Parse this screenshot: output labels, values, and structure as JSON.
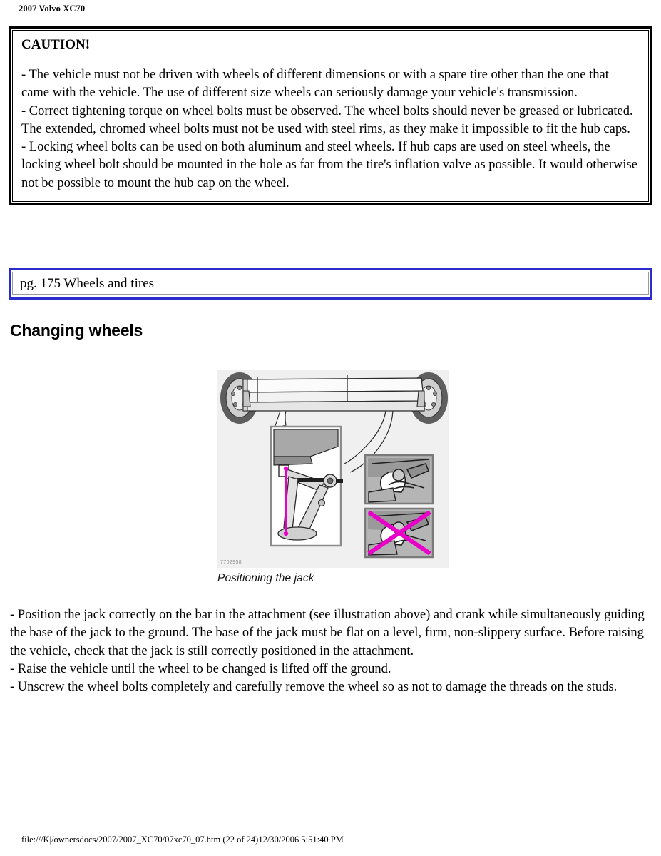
{
  "header": {
    "title": "2007 Volvo XC70"
  },
  "caution": {
    "title": "CAUTION!",
    "paragraphs": [
      "- The vehicle must not be driven with wheels of different dimensions or with a spare tire other than the one that came with the vehicle. The use of different size wheels can seriously damage your vehicle's transmission.",
      "- Correct tightening torque on wheel bolts must be observed. The wheel bolts should never be greased or lubricated. The extended, chromed wheel bolts must not be used with steel rims, as they make it impossible to fit the hub caps.",
      "- Locking wheel bolts can be used on both aluminum and steel wheels. If hub caps are used on steel wheels, the locking wheel bolt should be mounted in the hole as far from the tire's inflation valve as possible. It would otherwise not be possible to mount the hub cap on the wheel."
    ],
    "border_color": "#000000"
  },
  "reference_box": {
    "text": "pg. 175 Wheels and tires",
    "border_color": "#2c2ccc",
    "inner_border_color": "#9a9a9a"
  },
  "section": {
    "heading": "Changing wheels"
  },
  "figure": {
    "caption": "Positioning the jack",
    "image_id": "7702958",
    "background_color": "#f0f0f0",
    "highlight_color": "#e800c8",
    "alt": "Illustration of a vehicle side sill with jack attachment points, a detail view of the jack positioned on the bar in the attachment, a correct-placement inset and an incorrect-placement inset marked with a cross"
  },
  "body": {
    "paragraphs": [
      "- Position the jack correctly on the bar in the attachment (see illustration above) and crank while simultaneously guiding the base of the jack to the ground. The base of the jack must be flat on a level, firm, non-slippery surface. Before raising the vehicle, check that the jack is still correctly positioned in the attachment.",
      "- Raise the vehicle until the wheel to be changed is lifted off the ground.",
      "- Unscrew the wheel bolts completely and carefully remove the wheel so as not to damage the threads on the studs."
    ]
  },
  "footer": {
    "path": "file:///K|/ownersdocs/2007/2007_XC70/07xc70_07.htm (22 of 24)12/30/2006 5:51:40 PM"
  }
}
